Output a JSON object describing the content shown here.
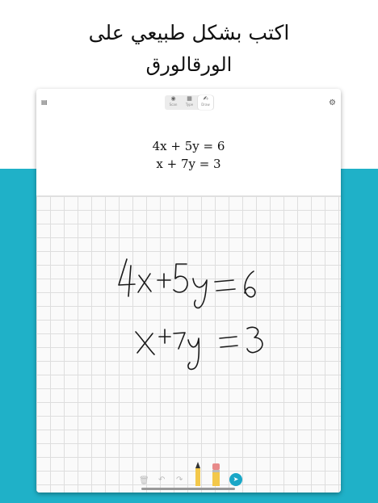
{
  "promo": {
    "caption_line1": "اكتب بشكل طبيعي على",
    "caption_line2": "الورقالورق"
  },
  "topbar": {
    "modes": [
      {
        "label": "Scan",
        "icon": "camera-icon"
      },
      {
        "label": "Type",
        "icon": "keyboard-icon"
      },
      {
        "label": "Draw",
        "icon": "hand-draw-icon"
      }
    ],
    "active_mode": "Draw"
  },
  "equations": {
    "line1": "4x + 5y = 6",
    "line2": "x + 7y = 3"
  },
  "handwriting": {
    "line1": "4x+5y=6",
    "line2": "x+7y=3"
  },
  "toolbar": {
    "tools": [
      "trash-icon",
      "undo-icon",
      "redo-icon",
      "pencil-icon",
      "eraser-icon",
      "send-icon"
    ]
  },
  "colors": {
    "accent": "#1aa7c7",
    "band": "#1fb1c8"
  }
}
